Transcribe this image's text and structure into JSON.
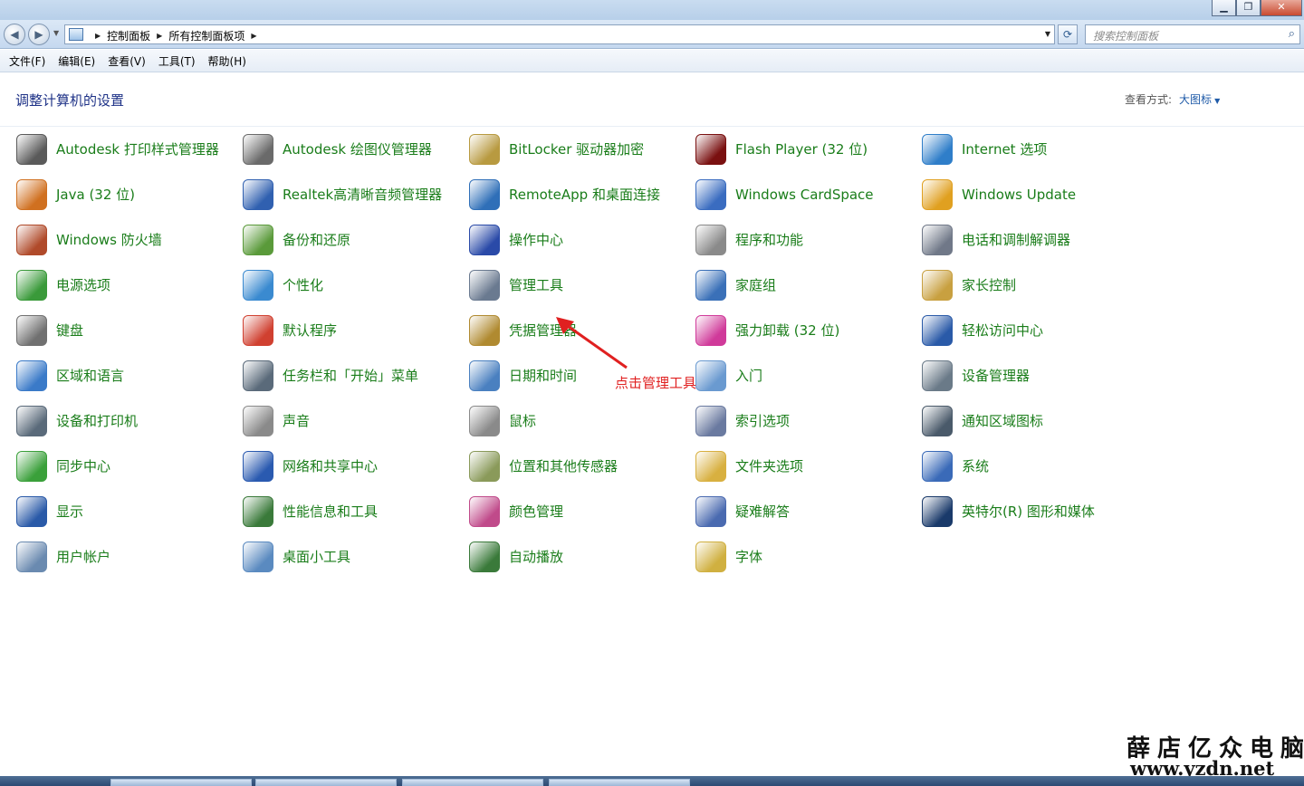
{
  "breadcrumb": [
    "控制面板",
    "所有控制面板项"
  ],
  "search": {
    "placeholder": "搜索控制面板"
  },
  "menu": [
    "文件(F)",
    "编辑(E)",
    "查看(V)",
    "工具(T)",
    "帮助(H)"
  ],
  "header": {
    "title": "调整计算机的设置",
    "view_by_label": "查看方式:",
    "view_by_value": "大图标"
  },
  "items": [
    [
      "Autodesk 打印样式管理器",
      "Autodesk 绘图仪管理器",
      "BitLocker 驱动器加密",
      "Flash Player (32 位)",
      "Internet 选项"
    ],
    [
      "Java (32 位)",
      "Realtek高清晰音频管理器",
      "RemoteApp 和桌面连接",
      "Windows CardSpace",
      "Windows Update"
    ],
    [
      "Windows 防火墙",
      "备份和还原",
      "操作中心",
      "程序和功能",
      "电话和调制解调器"
    ],
    [
      "电源选项",
      "个性化",
      "管理工具",
      "家庭组",
      "家长控制"
    ],
    [
      "键盘",
      "默认程序",
      "凭据管理器",
      "强力卸载 (32 位)",
      "轻松访问中心"
    ],
    [
      "区域和语言",
      "任务栏和「开始」菜单",
      "日期和时间",
      "入门",
      "设备管理器"
    ],
    [
      "设备和打印机",
      "声音",
      "鼠标",
      "索引选项",
      "通知区域图标"
    ],
    [
      "同步中心",
      "网络和共享中心",
      "位置和其他传感器",
      "文件夹选项",
      "系统"
    ],
    [
      "显示",
      "性能信息和工具",
      "颜色管理",
      "疑难解答",
      "英特尔(R) 图形和媒体"
    ],
    [
      "用户帐户",
      "桌面小工具",
      "自动播放",
      "字体",
      ""
    ]
  ],
  "icons": [
    [
      "printer-icon",
      "plotter-icon",
      "bitlocker-key-icon",
      "flash-icon",
      "internet-globe-icon"
    ],
    [
      "java-icon",
      "audio-manager-icon",
      "remoteapp-icon",
      "cardspace-icon",
      "windows-update-icon"
    ],
    [
      "firewall-icon",
      "backup-icon",
      "action-center-flag-icon",
      "programs-icon",
      "phone-modem-icon"
    ],
    [
      "power-icon",
      "personalize-icon",
      "admin-tools-icon",
      "homegroup-icon",
      "parental-icon"
    ],
    [
      "keyboard-icon",
      "default-programs-icon",
      "credential-icon",
      "uninstaller-icon",
      "ease-access-icon"
    ],
    [
      "region-globe-icon",
      "taskbar-icon",
      "datetime-icon",
      "getting-started-icon",
      "device-manager-icon"
    ],
    [
      "devices-printers-icon",
      "sound-icon",
      "mouse-icon",
      "index-icon",
      "tray-icons-icon"
    ],
    [
      "sync-icon",
      "network-icon",
      "sensor-icon",
      "folder-options-icon",
      "system-icon"
    ],
    [
      "display-icon",
      "performance-icon",
      "color-icon",
      "troubleshoot-icon",
      "intel-graphics-icon"
    ],
    [
      "user-accounts-icon",
      "gadgets-icon",
      "autoplay-icon",
      "fonts-icon",
      ""
    ]
  ],
  "icon_colors": [
    [
      "#5a5a5a",
      "#6a6a6a",
      "#b89a40",
      "#7a1010",
      "#2f7ec9"
    ],
    [
      "#d07020",
      "#3060b0",
      "#2f6fb8",
      "#3a6cc0",
      "#e0a020"
    ],
    [
      "#b04a2a",
      "#5a9a3a",
      "#2a4aa8",
      "#8a8a8a",
      "#707888"
    ],
    [
      "#3a9a3a",
      "#3a8ad0",
      "#6a7a90",
      "#3a70b8",
      "#c8a040"
    ],
    [
      "#707070",
      "#d04030",
      "#b08a30",
      "#d03a9a",
      "#2a5aa8"
    ],
    [
      "#3a7ac8",
      "#5a6a7a",
      "#4a80c0",
      "#6a9ad0",
      "#6a7a88"
    ],
    [
      "#5a6a7a",
      "#8a8a8a",
      "#8a8a8a",
      "#6a7aa0",
      "#4a5a6a"
    ],
    [
      "#3aa03a",
      "#2a5ab0",
      "#8a9a5a",
      "#d8b040",
      "#3a6ab8"
    ],
    [
      "#2a5aa8",
      "#3a7a3a",
      "#c04a8a",
      "#4a6ab0",
      "#1a3a6a"
    ],
    [
      "#6a8ab0",
      "#5a8ac0",
      "#3a7a3a",
      "#d0b040",
      ""
    ]
  ],
  "annotation": {
    "text": "点击管理工具"
  },
  "watermark": {
    "cn": "薛店亿众电脑",
    "url": "www.yzdn.net"
  },
  "colors": {
    "link_green": "#1a7d1a",
    "title_blue": "#1e3287",
    "annotation_red": "#e02020"
  }
}
